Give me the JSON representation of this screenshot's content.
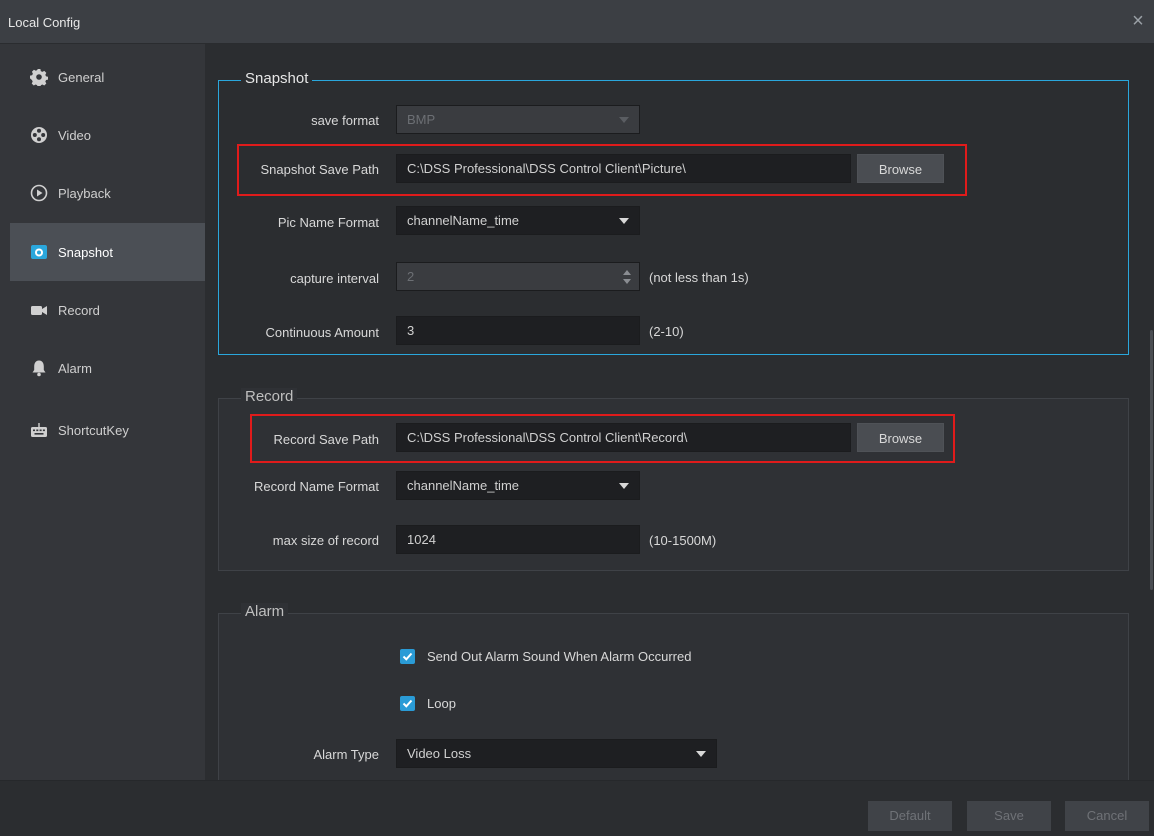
{
  "window": {
    "title": "Local Config",
    "close_icon": "×"
  },
  "sidebar": {
    "items": [
      {
        "label": "General",
        "icon": "gear-icon"
      },
      {
        "label": "Video",
        "icon": "video-reel-icon"
      },
      {
        "label": "Playback",
        "icon": "play-circle-icon"
      },
      {
        "label": "Snapshot",
        "icon": "camera-icon",
        "active": true
      },
      {
        "label": "Record",
        "icon": "video-camera-icon"
      },
      {
        "label": "Alarm",
        "icon": "bell-icon"
      },
      {
        "label": "ShortcutKey",
        "icon": "keyboard-icon"
      }
    ]
  },
  "snapshot": {
    "legend": "Snapshot",
    "save_format": {
      "label": "save format",
      "value": "BMP"
    },
    "save_path": {
      "label": "Snapshot Save Path",
      "value": "C:\\DSS Professional\\DSS Control Client\\Picture\\",
      "button": "Browse"
    },
    "name_format": {
      "label": "Pic Name Format",
      "value": "channelName_time"
    },
    "capture_interval": {
      "label": "capture interval",
      "value": "2",
      "hint": "(not less than 1s)"
    },
    "continuous_amount": {
      "label": "Continuous Amount",
      "value": "3",
      "hint": "(2-10)"
    }
  },
  "record": {
    "legend": "Record",
    "save_path": {
      "label": "Record Save Path",
      "value": "C:\\DSS Professional\\DSS Control Client\\Record\\",
      "button": "Browse"
    },
    "name_format": {
      "label": "Record Name Format",
      "value": "channelName_time"
    },
    "max_size": {
      "label": "max size of record",
      "value": "1024",
      "hint": "(10-1500M)"
    }
  },
  "alarm": {
    "legend": "Alarm",
    "sound_checkbox": {
      "label": "Send Out Alarm Sound When Alarm Occurred",
      "checked": true
    },
    "loop_checkbox": {
      "label": "Loop",
      "checked": true
    },
    "alarm_type": {
      "label": "Alarm Type",
      "value": "Video Loss"
    }
  },
  "footer": {
    "default_label": "Default",
    "save_label": "Save",
    "cancel_label": "Cancel"
  },
  "colors": {
    "accent": "#2aa7dc",
    "highlight": "#e01b1b",
    "checkbox": "#2a9bd6"
  }
}
